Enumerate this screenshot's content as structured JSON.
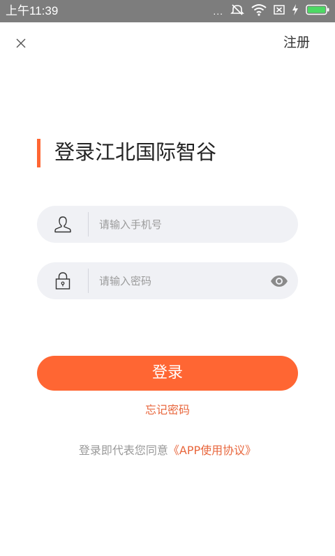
{
  "status_bar": {
    "time": "上午11:39",
    "dots": "...",
    "icons": [
      "more-dots-icon",
      "mute-icon",
      "wifi-icon",
      "sim-icon",
      "charging-icon",
      "battery-icon"
    ],
    "background": "#7d7d7d"
  },
  "nav": {
    "close_icon": "close-icon",
    "register_label": "注册"
  },
  "title": "登录江北国际智谷",
  "form": {
    "phone": {
      "icon": "user-icon",
      "placeholder": "请输入手机号",
      "value": ""
    },
    "password": {
      "icon": "lock-icon",
      "placeholder": "请输入密码",
      "value": "",
      "toggle_icon": "eye-icon"
    }
  },
  "login_button_label": "登录",
  "forgot_password_label": "忘记密码",
  "agreement": {
    "prefix": "登录即代表您同意",
    "link": "《APP使用协议》"
  },
  "colors": {
    "accent": "#ff6633",
    "link": "#e8663c",
    "field_background": "#f0f1f5"
  }
}
